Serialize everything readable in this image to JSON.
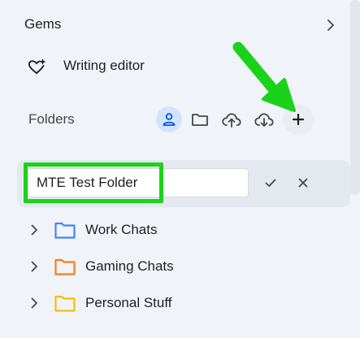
{
  "gems": {
    "label": "Gems"
  },
  "gem_items": [
    {
      "label": "Writing editor",
      "icon": "gem-sparkle-icon"
    }
  ],
  "folders": {
    "label": "Folders",
    "toolbar": [
      "person-icon",
      "folder-icon",
      "cloud-upload-icon",
      "cloud-download-icon",
      "add-icon"
    ]
  },
  "new_folder": {
    "value": "MTE Test Folder",
    "confirm_icon": "check-icon",
    "cancel_icon": "close-icon"
  },
  "folder_list": [
    {
      "label": "Work Chats",
      "color": "#4285f4"
    },
    {
      "label": "Gaming Chats",
      "color": "#fa7b17"
    },
    {
      "label": "Personal Stuff",
      "color": "#fbbc04"
    }
  ],
  "colors": {
    "background": "#f0f4f9",
    "annotation": "#1bd21b",
    "active_toggle": "#d3e3fd"
  }
}
